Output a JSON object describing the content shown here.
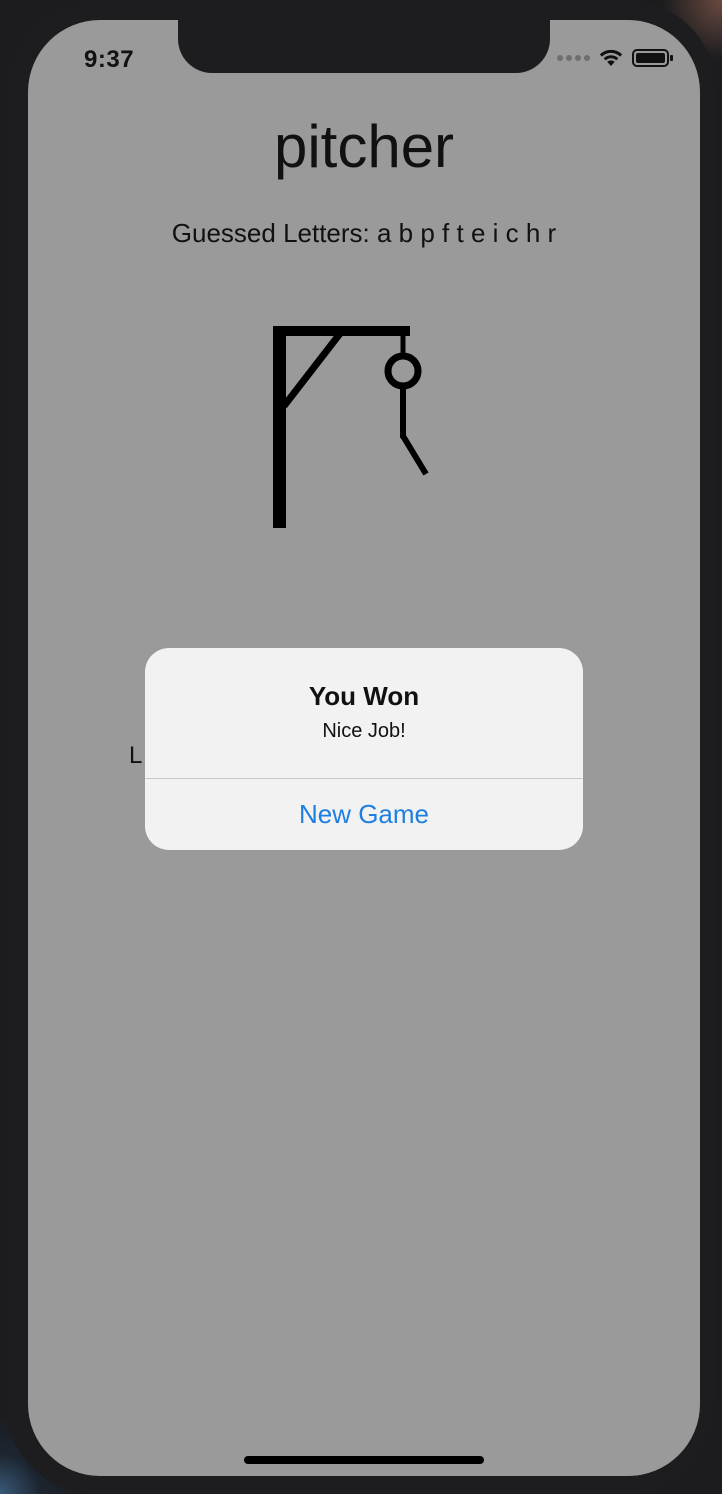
{
  "status_bar": {
    "time": "9:37",
    "signal_icon": "cellular-signal-icon",
    "wifi_icon": "wifi-icon",
    "battery_icon": "battery-icon"
  },
  "game": {
    "word": "pitcher",
    "guessed_label": "Guessed Letters: a b p f t e i c h r",
    "obscured_label_partial": "L"
  },
  "alert": {
    "title": "You Won",
    "message": "Nice Job!",
    "button_label": "New Game"
  },
  "colors": {
    "screen_background": "#9a9a9a",
    "alert_background": "#f5f5f5",
    "alert_button_text": "#1e7fe0"
  }
}
